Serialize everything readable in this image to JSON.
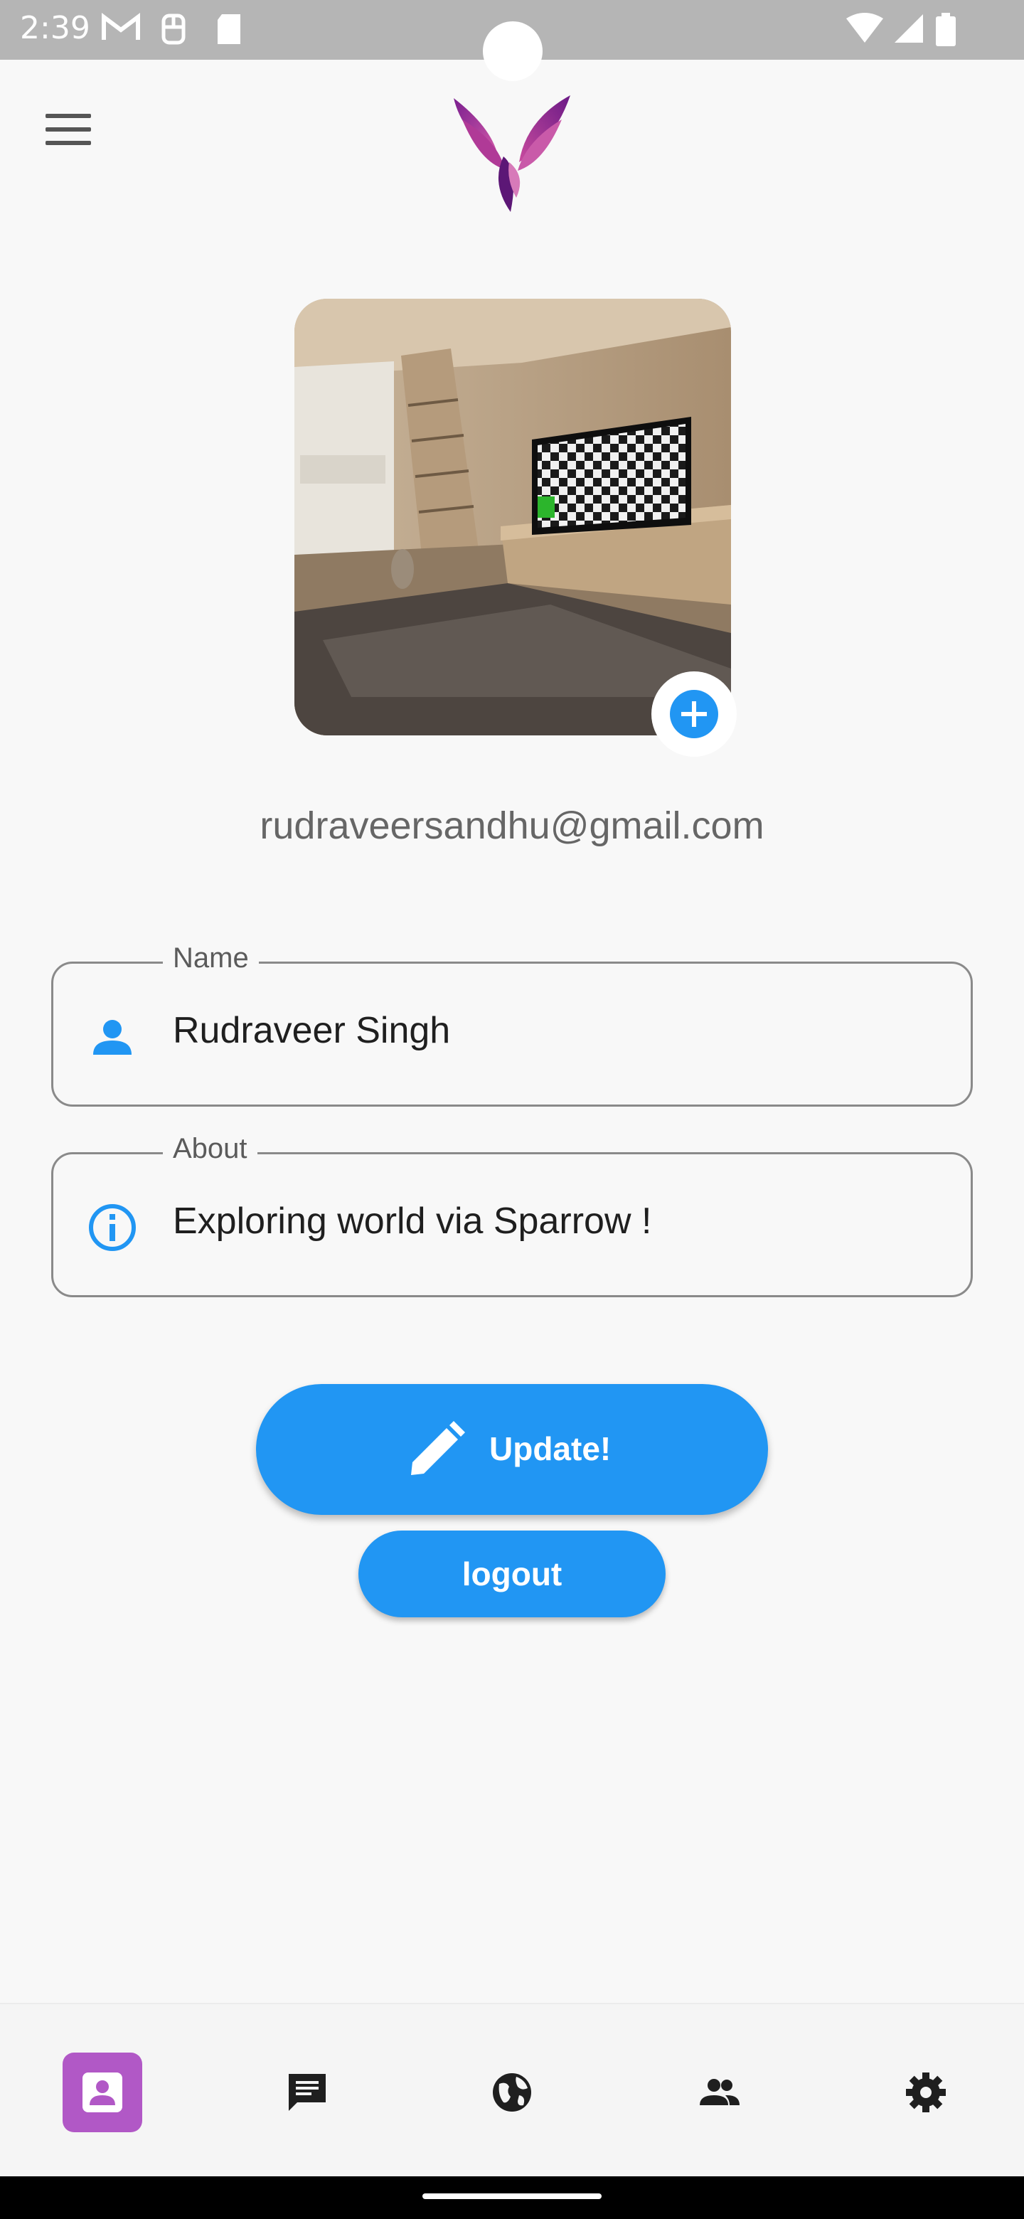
{
  "status_bar": {
    "time": "2:39",
    "icons": [
      "gmail-icon",
      "notification-icon",
      "sd-card-icon",
      "wifi-icon",
      "signal-icon",
      "battery-icon"
    ]
  },
  "header": {
    "menu_icon": "hamburger-menu-icon",
    "logo": "sparrow-bird-logo"
  },
  "profile": {
    "email": "rudraveersandhu@gmail.com",
    "add_photo_icon": "add-circle-icon"
  },
  "fields": {
    "name": {
      "label": "Name",
      "value": "Rudraveer Singh",
      "icon": "person-icon"
    },
    "about": {
      "label": "About",
      "value": "Exploring world via Sparrow !",
      "icon": "info-icon"
    }
  },
  "actions": {
    "update_label": "Update!",
    "update_icon": "pencil-icon",
    "logout_label": "logout"
  },
  "bottom_nav": {
    "items": [
      {
        "icon": "person-icon",
        "active": true
      },
      {
        "icon": "chat-icon",
        "active": false
      },
      {
        "icon": "globe-icon",
        "active": false
      },
      {
        "icon": "people-icon",
        "active": false
      },
      {
        "icon": "settings-icon",
        "active": false
      }
    ]
  },
  "colors": {
    "primary": "#2196f3",
    "nav_active": "#b158c6",
    "status_bar": "#b5b5b5",
    "background": "#f8f8f8"
  }
}
